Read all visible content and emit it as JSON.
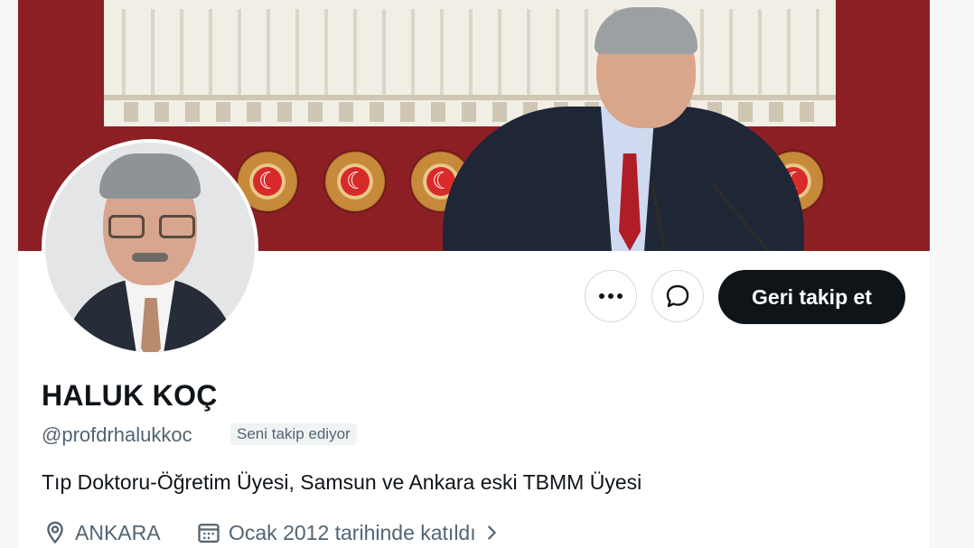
{
  "profile": {
    "display_name": "HALUK KOÇ",
    "handle": "@profdrhalukkoc",
    "follows_you_badge": "Seni takip ediyor",
    "bio": "Tıp Doktoru-Öğretim Üyesi, Samsun ve Ankara eski TBMM Üyesi",
    "location": "ANKARA",
    "joined": "Ocak 2012 tarihinde katıldı"
  },
  "actions": {
    "follow_back_label": "Geri takip et"
  },
  "icons": {
    "more": "more-options-icon",
    "message": "message-icon",
    "location": "location-pin-icon",
    "calendar": "calendar-icon",
    "chevron": "chevron-right-icon"
  },
  "colors": {
    "primary_text": "#0f1419",
    "secondary_text": "#536471",
    "button_dark": "#0f1419",
    "banner_red": "#8c1f24"
  }
}
